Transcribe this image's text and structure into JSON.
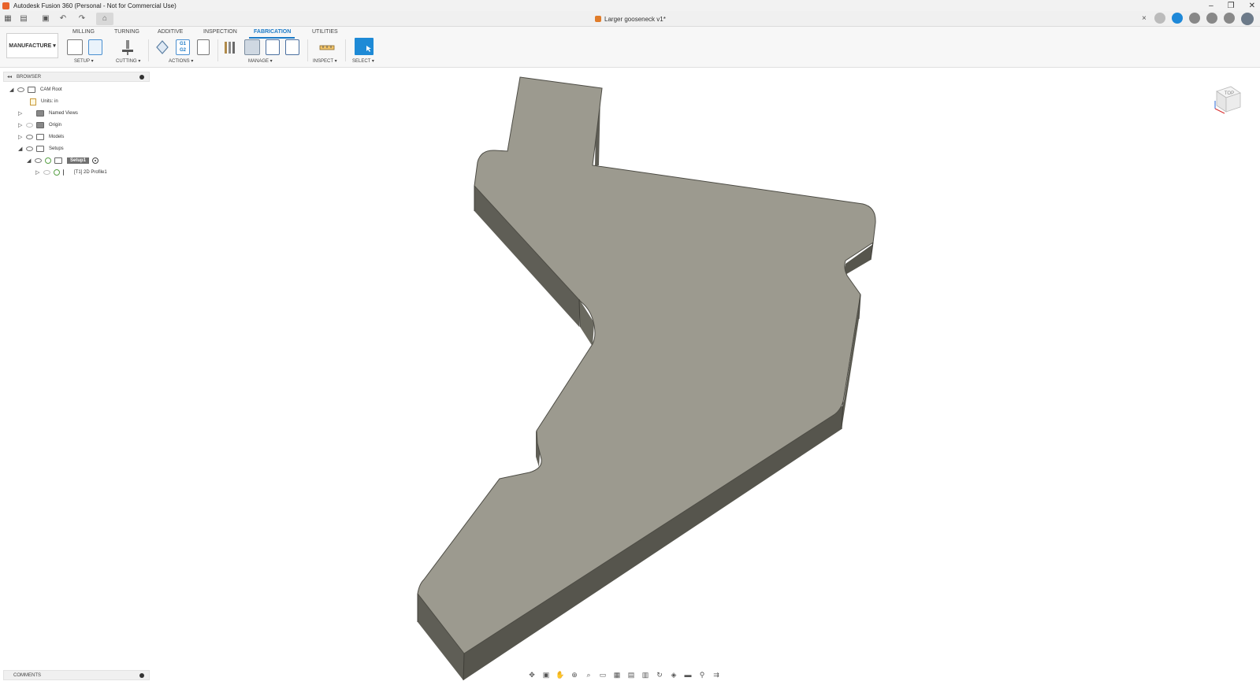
{
  "window": {
    "title": "Autodesk Fusion 360 (Personal - Not for Commercial Use)",
    "controls": [
      "–",
      "❐",
      "✕"
    ]
  },
  "document": {
    "tab_title": "Larger gooseneck v1*",
    "close": "×"
  },
  "quick_access": {
    "apps": "▦",
    "file": "▤",
    "save": "▣",
    "undo": "↶",
    "redo": "↷",
    "home": "⌂"
  },
  "ribbon": {
    "workspace": "MANUFACTURE ▾",
    "tabs": [
      "MILLING",
      "TURNING",
      "ADDITIVE",
      "INSPECTION",
      "FABRICATION",
      "UTILITIES"
    ],
    "active_tab": "FABRICATION",
    "groups": [
      "SETUP ▾",
      "CUTTING ▾",
      "ACTIONS ▾",
      "MANAGE ▾",
      "INSPECT ▾",
      "SELECT ▾"
    ],
    "nc_label": "G1\nG2",
    "accent_color": "#1b7ac7"
  },
  "browser": {
    "collapse": "◂◂",
    "title": "BROWSER",
    "items": [
      {
        "label": "CAM Root"
      },
      {
        "label": "Units: in"
      },
      {
        "label": "Named Views"
      },
      {
        "label": "Origin"
      },
      {
        "label": "Models"
      },
      {
        "label": "Setups"
      },
      {
        "label": "Setup1"
      },
      {
        "label": "[T1] 2D Profile1"
      }
    ]
  },
  "comments": {
    "title": "COMMENTS"
  },
  "viewcube": {
    "face": "TOP"
  },
  "model": {
    "top_color": "#9c9a8f",
    "side_color": "#5f5e56"
  }
}
